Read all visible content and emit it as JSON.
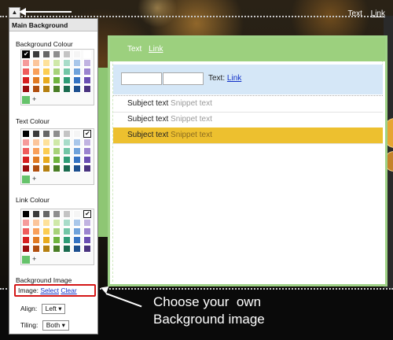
{
  "top_links": {
    "text": "Text",
    "link": "Link"
  },
  "panel": {
    "title": "Main Background",
    "bg_label": "Background Colour",
    "text_label": "Text Colour",
    "link_label": "Link Colour",
    "image_label": "Background Image",
    "image_row": {
      "prefix": "Image:",
      "select": "Select",
      "clear": "Clear"
    },
    "align": {
      "label": "Align:",
      "value": "Left"
    },
    "tiling": {
      "label": "Tiling:",
      "value": "Both"
    },
    "add_symbol": "+",
    "palette_colors": [
      [
        "#000000",
        "#3a3a3a",
        "#666666",
        "#8e8e8e",
        "#c4c4c4",
        "#f5f5f5",
        "#ffffff"
      ],
      [
        "#f59a9a",
        "#fbc59a",
        "#fde19a",
        "#cfe8a8",
        "#a8dcc9",
        "#a9c7ea",
        "#c1b3e1"
      ],
      [
        "#ef5c5c",
        "#f8a05a",
        "#fbcd53",
        "#a7d27a",
        "#72c6a6",
        "#6fa2db",
        "#9b84cf"
      ],
      [
        "#d62020",
        "#e07b22",
        "#e8ab1e",
        "#6fb43f",
        "#2f9d77",
        "#3573c3",
        "#6a4fb3"
      ],
      [
        "#9b0f0f",
        "#b04f0f",
        "#b58011",
        "#4a7e26",
        "#1a6b4f",
        "#1d4f8f",
        "#4a3480"
      ]
    ]
  },
  "preview": {
    "header_text": "Text",
    "header_link": "Link",
    "search_text": "Text:",
    "search_link": "Link",
    "rows": [
      {
        "subject": "Subject text",
        "snippet": "Snippet text"
      },
      {
        "subject": "Subject text",
        "snippet": "Snippet text"
      },
      {
        "subject": "Subject text",
        "snippet": "Snippet text"
      }
    ]
  },
  "annotation": "Choose your  own\nBackground image"
}
